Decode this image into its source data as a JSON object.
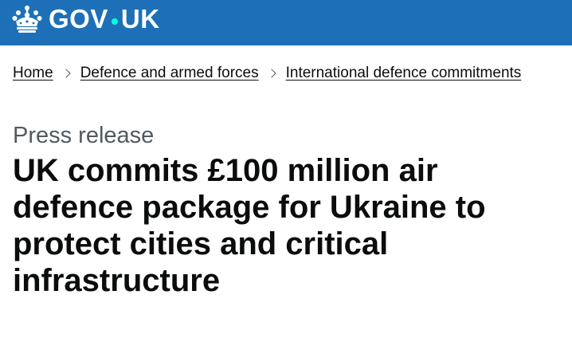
{
  "header": {
    "logo_text_left": "GOV",
    "logo_text_right": "UK",
    "crown_icon": "crown-icon",
    "brand_color": "#1d70b8",
    "dot_color": "#00ffe0"
  },
  "breadcrumbs": {
    "items": [
      {
        "label": "Home"
      },
      {
        "label": "Defence and armed forces"
      },
      {
        "label": "International defence commitments"
      }
    ]
  },
  "article": {
    "caption": "Press release",
    "title": "UK commits £100 million air defence package for Ukraine to protect cities and critical infrastructure"
  }
}
